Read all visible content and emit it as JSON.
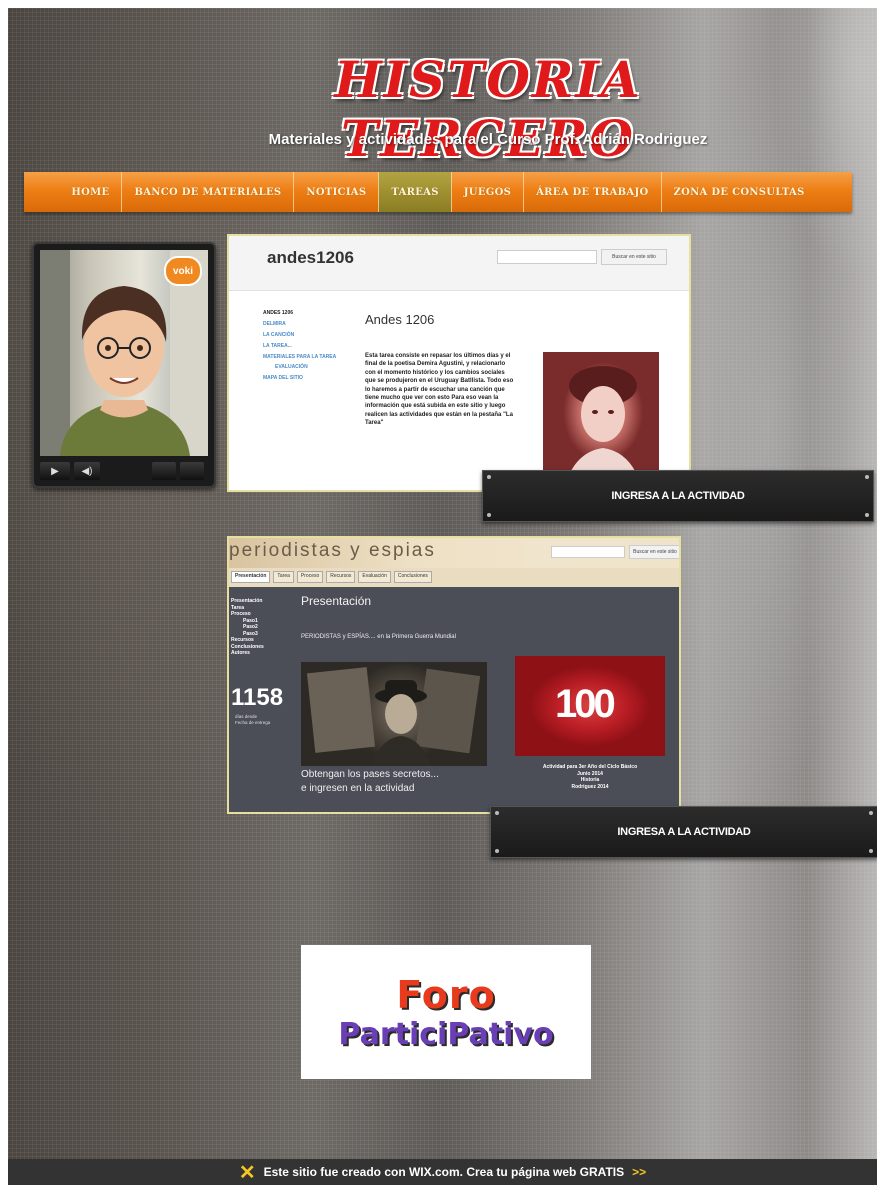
{
  "header": {
    "title": "HISTORIA TERCERO",
    "subtitle": "Materiales y actividades para el Curso  Prof. Adrián Rodriguez"
  },
  "nav": {
    "items": [
      "HOME",
      "Banco de Materiales",
      "Noticias",
      "Tareas",
      "Juegos",
      "Área de Trabajo",
      "Zona de Consultas"
    ],
    "active": "Tareas"
  },
  "avatar": {
    "badge": "voki"
  },
  "card1": {
    "site_name": "andes1206",
    "search_button": "Buscar en este sitio",
    "sidebar": [
      "ANDES 1206",
      "DELMIRA",
      "LA CANCIÓN",
      "LA TAREA...",
      "MATERIALES PARA LA TAREA",
      "EVALUACIÓN",
      "MAPA DEL SITIO"
    ],
    "heading": "Andes 1206",
    "body": "Esta tarea consiste en repasar los últimos días y el final de la poetisa Demira Agustini, y relacionarlo con el momento histórico y los cambios sociales que se produjeron en el Uruguay Batllista. Todo eso lo haremos a partir de escuchar una canción que tiene mucho que ver con esto Para eso vean la información que está subida en este sitio y luego realicen las actividades que están en la pestaña \"La Tarea\""
  },
  "card2": {
    "banner": "periodistas y espias",
    "search_button": "Buscar en este sitio",
    "tabs": [
      "Presentación",
      "Tarea",
      "Proceso",
      "Recursos",
      "Evaluación",
      "Conclusiones"
    ],
    "sidebar": [
      "Presentación",
      "Tarea",
      "Proceso",
      "Paso1",
      "Paso2",
      "Paso3",
      "Recursos",
      "Conclusiones",
      "Autores"
    ],
    "counter": "1158",
    "counter_caption_1": "días desde",
    "counter_caption_2": "Fecha de entrega",
    "heading": "Presentación",
    "intro": "PERIODISTAS y ESPÍAS.... en la Primera Guerra Mundial",
    "caption_line1": "Obtengan los pases secretos...",
    "caption_line2": "e ingresen en la actividad",
    "centenary_mark": "100",
    "small_caption": [
      "Actividad para 3er Año del Ciclo Básico",
      "Junio 2014",
      "Historia",
      "Rodriguez 2014"
    ]
  },
  "cta": {
    "label": "INGRESA A LA ACTIVIDAD"
  },
  "forum": {
    "line1": "Foro",
    "line2": "ParticiPativo"
  },
  "footer": {
    "text": "Este sitio fue creado con WIX.com. Crea tu página web GRATIS",
    "link": ">>"
  }
}
